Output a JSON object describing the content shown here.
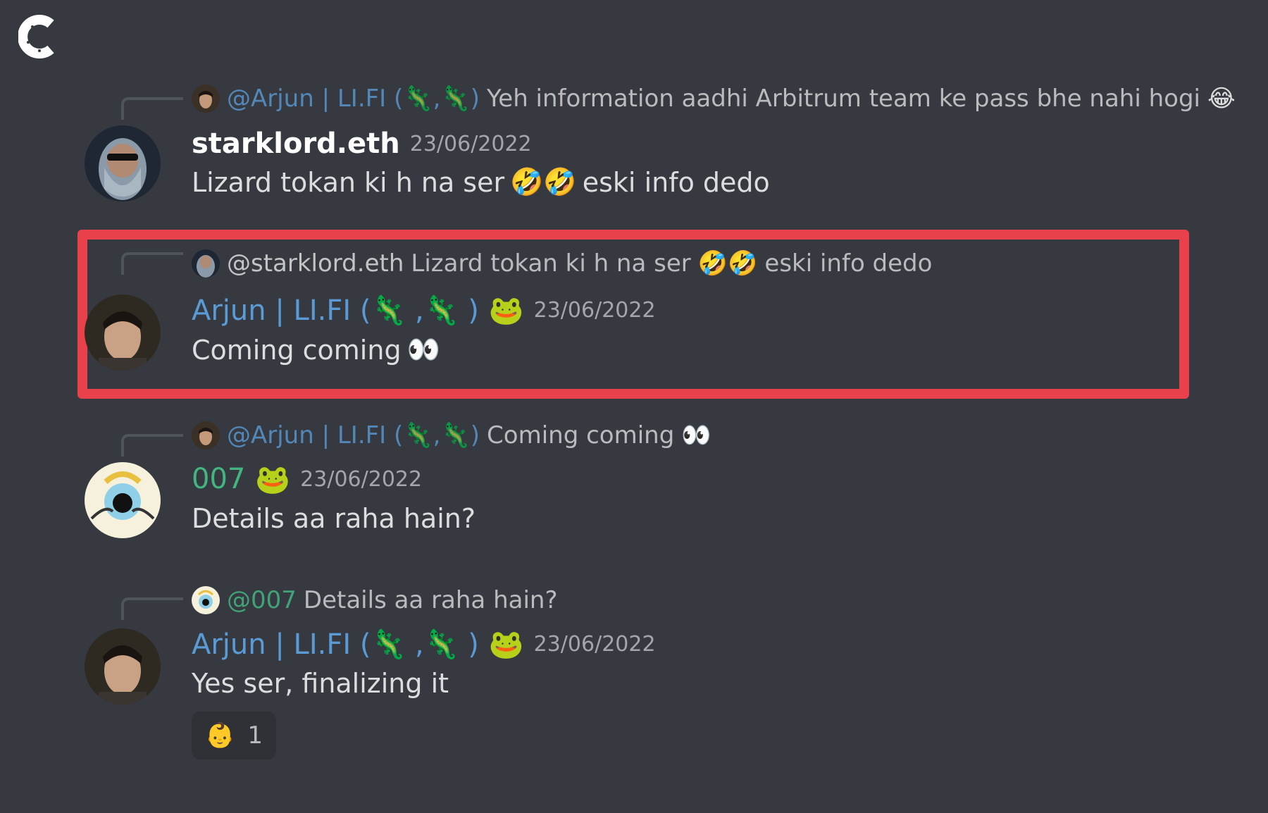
{
  "messages": [
    {
      "reply": {
        "author": "@Arjun | LI.FI (🦎,🦎)",
        "text": "Yeh information aadhi Arbitrum team ke pass bhe nahi hogi",
        "emoji": "😂"
      },
      "author": "starklord.eth",
      "timestamp": "23/06/2022",
      "text_before": "Lizard tokan ki h na ser",
      "emojis": "🤣🤣",
      "text_after": "eski info dedo"
    },
    {
      "reply": {
        "author": "@starklord.eth",
        "text": "Lizard tokan ki h na ser",
        "emoji": "🤣🤣",
        "text_after": "eski info dedo"
      },
      "author": "Arjun | LI.FI (🦎 ,🦎 )",
      "badge": "🐸",
      "timestamp": "23/06/2022",
      "text": "Coming coming",
      "emoji": "👀"
    },
    {
      "reply": {
        "author": "@Arjun | LI.FI (🦎,🦎)",
        "text": "Coming coming",
        "emoji": "👀"
      },
      "author": "007",
      "badge": "🐸",
      "timestamp": "23/06/2022",
      "text": "Details aa raha hain?"
    },
    {
      "reply": {
        "author": "@007",
        "text": "Details aa raha hain?"
      },
      "author": "Arjun | LI.FI (🦎 ,🦎 )",
      "badge": "🐸",
      "timestamp": "23/06/2022",
      "text": "Yes ser, finalizing it",
      "reaction": {
        "emoji": "👶",
        "count": "1"
      }
    }
  ],
  "colors": {
    "background": "#36393f",
    "highlight_border": "#e8414b",
    "blue_name": "#5b9bd5",
    "green_name": "#43b581"
  }
}
